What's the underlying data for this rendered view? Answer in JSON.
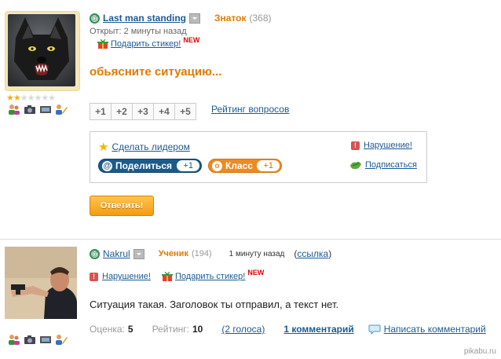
{
  "question": {
    "username": "Last man standing",
    "rank": "Знаток",
    "rank_count": "(368)",
    "opened": "Открыт: 2 минуты назад",
    "gift_sticker": "Подарить стикер!",
    "new_badge": "NEW",
    "title": "обьясните ситуацию...",
    "plus_buttons": [
      "+1",
      "+2",
      "+3",
      "+4",
      "+5"
    ],
    "rating_link": "Рейтинг вопросов",
    "make_leader": "Сделать лидером",
    "violation": "Нарушение!",
    "subscribe": "Подписаться",
    "share_label": "Поделиться",
    "share_count": "+1",
    "class_label": "Класс",
    "class_count": "+1",
    "answer_button": "Ответить!",
    "stars_filled": 2,
    "stars_total": 7
  },
  "answer": {
    "username": "Nakrul",
    "rank": "Ученик",
    "rank_count": "(194)",
    "time": "1 минуту назад",
    "link_open": "(",
    "link_label": "ссылка",
    "link_close": ")",
    "violation": "Нарушение!",
    "gift_sticker": "Подарить стикер!",
    "new_badge": "NEW",
    "text": "Ситуация такая. Заголовок ты отправил, а текст нет.",
    "score_label": "Оценка:",
    "score_value": "5",
    "rating_label": "Рейтинг:",
    "rating_value": "10",
    "votes": "(2 голоса)",
    "comments": "1 комментарий",
    "write_comment": "Написать комментарий"
  },
  "watermark": "pikabu.ru",
  "colors": {
    "accent_orange": "#e07b00",
    "link_blue": "#1c5a94"
  }
}
